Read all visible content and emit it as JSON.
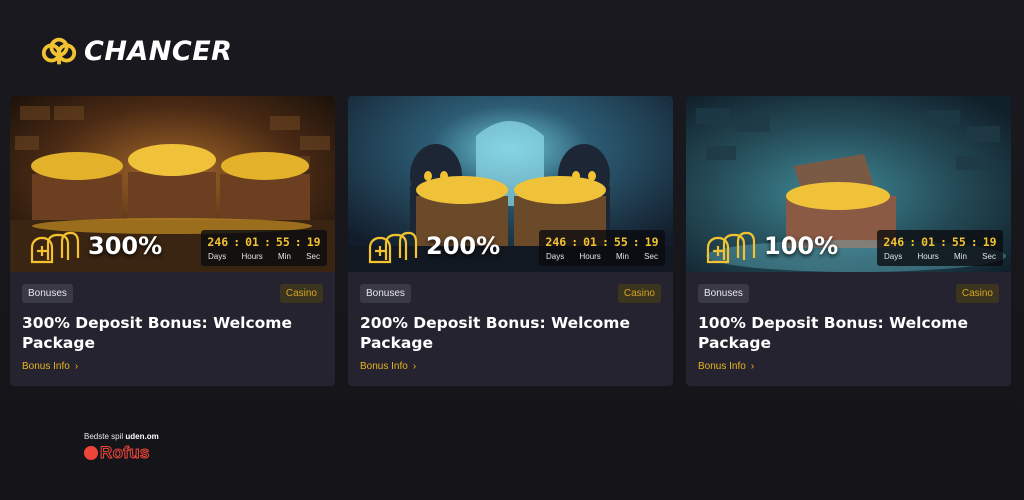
{
  "brand": {
    "name": "CHANCER",
    "logo_color": "#f2c230"
  },
  "timer_labels": {
    "days": "Days",
    "hours": "Hours",
    "min": "Min",
    "sec": "Sec"
  },
  "cards": [
    {
      "percent": "300%",
      "timer": {
        "days": "246",
        "hours": "01",
        "min": "55",
        "sec": "19"
      },
      "tag": "Bonuses",
      "category": "Casino",
      "title": "300% Deposit Bonus: Welcome Package",
      "link": "Bonus Info"
    },
    {
      "percent": "200%",
      "timer": {
        "days": "246",
        "hours": "01",
        "min": "55",
        "sec": "19"
      },
      "tag": "Bonuses",
      "category": "Casino",
      "title": "200% Deposit Bonus: Welcome Package",
      "link": "Bonus Info"
    },
    {
      "percent": "100%",
      "timer": {
        "days": "246",
        "hours": "01",
        "min": "55",
        "sec": "19"
      },
      "tag": "Bonuses",
      "category": "Casino",
      "title": "100% Deposit Bonus: Welcome Package",
      "link": "Bonus Info"
    }
  ],
  "rofus": {
    "caption_prefix": "Bedste spil ",
    "caption_bold": "uden.om",
    "name": "Rofus"
  },
  "colors": {
    "accent": "#f2c230",
    "card_bg": "#24232f",
    "page_bg": "#17171c"
  }
}
